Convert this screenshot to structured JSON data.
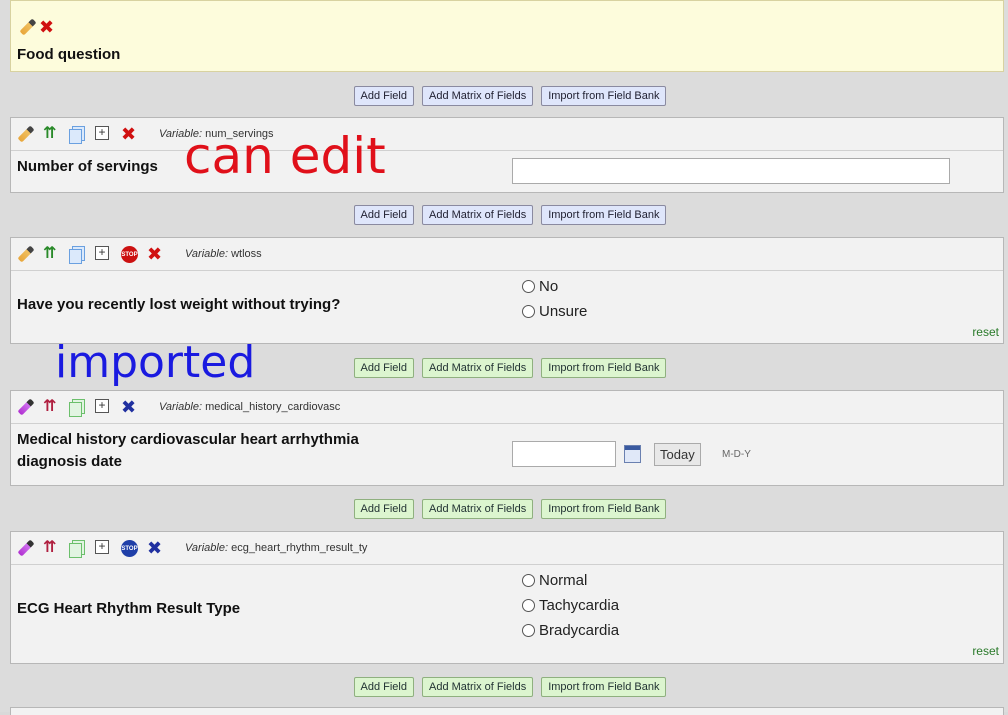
{
  "section": {
    "title": "Food question"
  },
  "buttons": {
    "add_field": "Add Field",
    "add_matrix": "Add Matrix of Fields",
    "import_bank": "Import from Field Bank"
  },
  "variable_prefix": "Variable:",
  "fields": [
    {
      "variable": "num_servings",
      "label": "Number of servings",
      "type": "text",
      "value": ""
    },
    {
      "variable": "wtloss",
      "label": "Have you recently lost weight without trying?",
      "type": "radio",
      "options": [
        "No",
        "Unsure"
      ],
      "reset": "reset"
    },
    {
      "variable": "medical_history_cardiovasc",
      "label_line1": "Medical history cardiovascular heart arrhythmia",
      "label_line2": "diagnosis date",
      "type": "date",
      "today": "Today",
      "format": "M-D-Y"
    },
    {
      "variable": "ecg_heart_rhythm_result_ty",
      "label": "ECG Heart Rhythm Result Type",
      "type": "radio",
      "options": [
        "Normal",
        "Tachycardia",
        "Bradycardia"
      ],
      "reset": "reset"
    }
  ],
  "annotations": {
    "can_edit": "can edit",
    "imported": "imported"
  },
  "colors": {
    "annotation_red": "#e0101a",
    "annotation_blue": "#1a1ae0",
    "section_bg": "#fdfcdc",
    "button_blue": "#dfe6fb",
    "button_green": "#dcf5cf"
  }
}
